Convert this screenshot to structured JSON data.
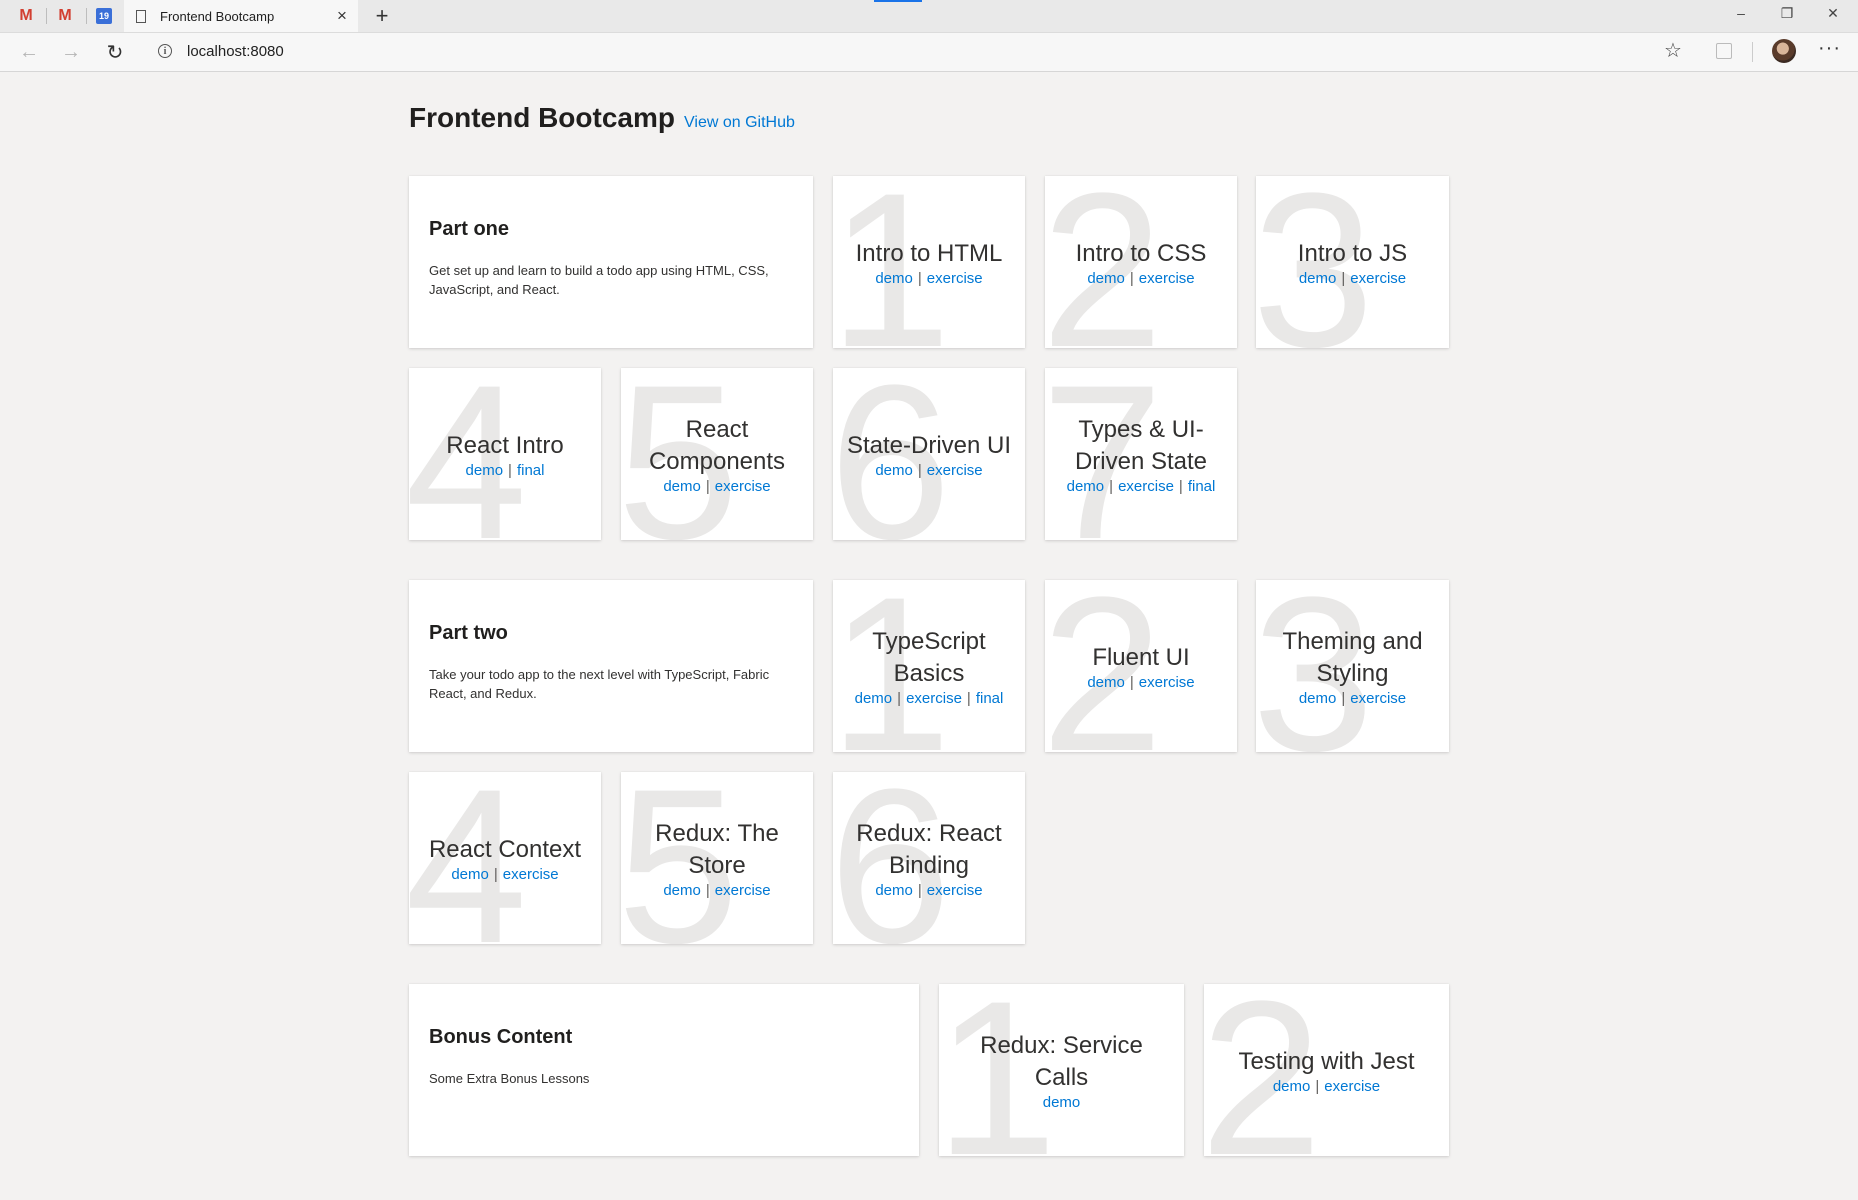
{
  "browser": {
    "tab_title": "Frontend Bootcamp",
    "address": "localhost:8080",
    "pinned_calendar_label": "19"
  },
  "page": {
    "title": "Frontend Bootcamp",
    "github_link": "View on GitHub"
  },
  "sections": [
    {
      "title": "Part one",
      "description": "Get set up and learn to build a todo app using HTML, CSS, JavaScript, and React.",
      "lessons": [
        {
          "number": "1",
          "title": "Intro to HTML",
          "links": [
            "demo",
            "exercise"
          ]
        },
        {
          "number": "2",
          "title": "Intro to CSS",
          "links": [
            "demo",
            "exercise"
          ]
        },
        {
          "number": "3",
          "title": "Intro to JS",
          "links": [
            "demo",
            "exercise"
          ]
        },
        {
          "number": "4",
          "title": "React Intro",
          "links": [
            "demo",
            "final"
          ]
        },
        {
          "number": "5",
          "title": "React Components",
          "links": [
            "demo",
            "exercise"
          ]
        },
        {
          "number": "6",
          "title": "State-Driven UI",
          "links": [
            "demo",
            "exercise"
          ]
        },
        {
          "number": "7",
          "title": "Types & UI-Driven State",
          "links": [
            "demo",
            "exercise",
            "final"
          ]
        }
      ]
    },
    {
      "title": "Part two",
      "description": "Take your todo app to the next level with TypeScript, Fabric React, and Redux.",
      "lessons": [
        {
          "number": "1",
          "title": "TypeScript Basics",
          "links": [
            "demo",
            "exercise",
            "final"
          ]
        },
        {
          "number": "2",
          "title": "Fluent UI",
          "links": [
            "demo",
            "exercise"
          ]
        },
        {
          "number": "3",
          "title": "Theming and Styling",
          "links": [
            "demo",
            "exercise"
          ]
        },
        {
          "number": "4",
          "title": "React Context",
          "links": [
            "demo",
            "exercise"
          ]
        },
        {
          "number": "5",
          "title": "Redux: The Store",
          "links": [
            "demo",
            "exercise"
          ]
        },
        {
          "number": "6",
          "title": "Redux: React Binding",
          "links": [
            "demo",
            "exercise"
          ]
        }
      ]
    },
    {
      "title": "Bonus Content",
      "description": "Some Extra Bonus Lessons",
      "lessons": [
        {
          "number": "1",
          "title": "Redux: Service Calls",
          "links": [
            "demo"
          ]
        },
        {
          "number": "2",
          "title": "Testing with Jest",
          "links": [
            "demo",
            "exercise"
          ]
        }
      ]
    }
  ]
}
